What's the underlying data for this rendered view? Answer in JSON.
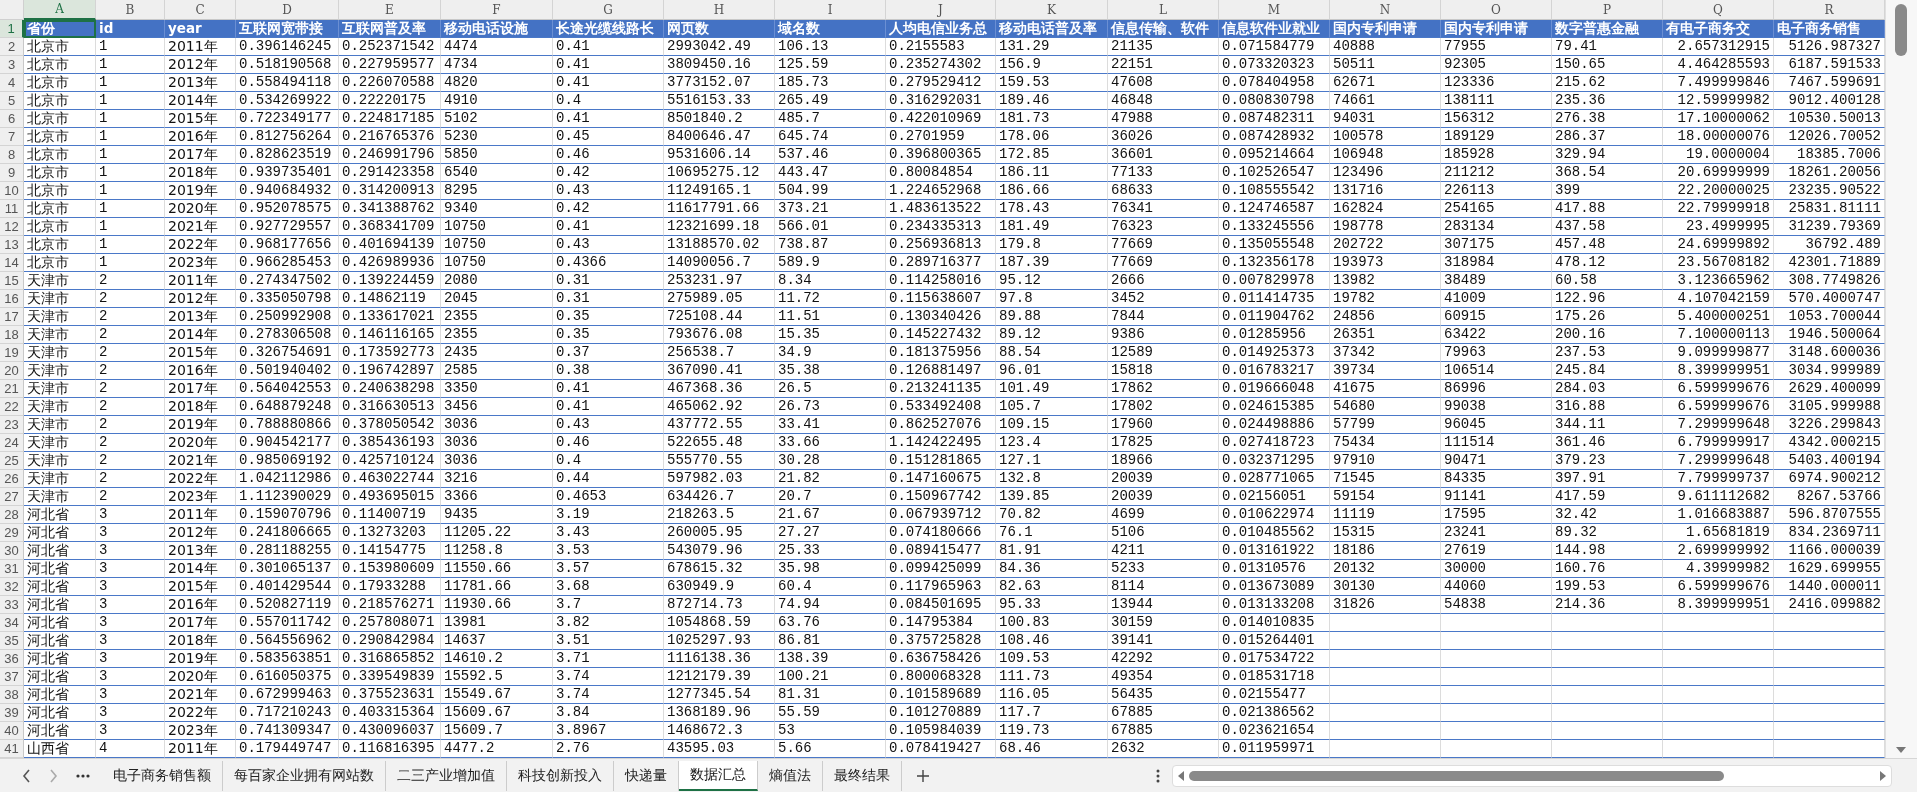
{
  "column_letters": [
    {
      "label": "A",
      "selected": true
    },
    {
      "label": "B",
      "selected": false
    },
    {
      "label": "C",
      "selected": false
    },
    {
      "label": "D",
      "selected": false
    },
    {
      "label": "E",
      "selected": false
    },
    {
      "label": "F",
      "selected": false
    },
    {
      "label": "G",
      "selected": false
    },
    {
      "label": "H",
      "selected": false
    },
    {
      "label": "I",
      "selected": false
    },
    {
      "label": "J",
      "selected": false
    },
    {
      "label": "K",
      "selected": false
    },
    {
      "label": "L",
      "selected": false
    },
    {
      "label": "M",
      "selected": false
    },
    {
      "label": "N",
      "selected": false
    },
    {
      "label": "O",
      "selected": false
    },
    {
      "label": "P",
      "selected": false
    },
    {
      "label": "Q",
      "selected": false
    },
    {
      "label": "R",
      "selected": false
    }
  ],
  "header_row": {
    "number": "1",
    "selected": true,
    "cells": [
      "省份",
      "id",
      "year",
      "互联网宽带接",
      "互联网普及率",
      "移动电话设施",
      "长途光缆线路长",
      "网页数",
      "域名数",
      "人均电信业务总",
      "移动电话普及率",
      "信息传输、软件",
      "信息软件业就业",
      "国内专利申请",
      "国内专利申请",
      "数字普惠金融",
      "有电子商务交",
      "电子商务销售"
    ]
  },
  "rows": [
    {
      "number": "2",
      "selected": false,
      "cells": [
        "北京市",
        "1",
        "2011年",
        "0.396146245",
        "0.252371542",
        "4474",
        "0.41",
        "2993042.49",
        "106.13",
        "0.2155583",
        "131.29",
        "21135",
        "0.071584779",
        "40888",
        "77955",
        "79.41",
        "2.657312915",
        "5126.987327"
      ]
    },
    {
      "number": "3",
      "selected": false,
      "cells": [
        "北京市",
        "1",
        "2012年",
        "0.518190568",
        "0.227959577",
        "4734",
        "0.41",
        "3809450.16",
        "125.59",
        "0.235274302",
        "156.9",
        "22151",
        "0.073320323",
        "50511",
        "92305",
        "150.65",
        "4.464285593",
        "6187.591533"
      ]
    },
    {
      "number": "4",
      "selected": false,
      "cells": [
        "北京市",
        "1",
        "2013年",
        "0.558494118",
        "0.226070588",
        "4820",
        "0.41",
        "3773152.07",
        "185.73",
        "0.279529412",
        "159.53",
        "47608",
        "0.078404958",
        "62671",
        "123336",
        "215.62",
        "7.499999846",
        "7467.599691"
      ]
    },
    {
      "number": "5",
      "selected": false,
      "cells": [
        "北京市",
        "1",
        "2014年",
        "0.534269922",
        "0.22220175",
        "4910",
        "0.4",
        "5516153.33",
        "265.49",
        "0.316292031",
        "189.46",
        "46848",
        "0.080830798",
        "74661",
        "138111",
        "235.36",
        "12.59999982",
        "9012.400128"
      ]
    },
    {
      "number": "6",
      "selected": false,
      "cells": [
        "北京市",
        "1",
        "2015年",
        "0.722349177",
        "0.224817185",
        "5102",
        "0.41",
        "8501840.2",
        "485.7",
        "0.422010969",
        "181.73",
        "47988",
        "0.087482311",
        "94031",
        "156312",
        "276.38",
        "17.10000062",
        "10530.50013"
      ]
    },
    {
      "number": "7",
      "selected": false,
      "cells": [
        "北京市",
        "1",
        "2016年",
        "0.812756264",
        "0.216765376",
        "5230",
        "0.45",
        "8400646.47",
        "645.74",
        "0.2701959",
        "178.06",
        "36026",
        "0.087428932",
        "100578",
        "189129",
        "286.37",
        "18.00000076",
        "12026.70052"
      ]
    },
    {
      "number": "8",
      "selected": false,
      "cells": [
        "北京市",
        "1",
        "2017年",
        "0.828623519",
        "0.246991796",
        "5850",
        "0.46",
        "9531606.14",
        "537.46",
        "0.396800365",
        "172.85",
        "36601",
        "0.095214664",
        "106948",
        "185928",
        "329.94",
        "19.0000004",
        "18385.7006"
      ]
    },
    {
      "number": "9",
      "selected": false,
      "cells": [
        "北京市",
        "1",
        "2018年",
        "0.939735401",
        "0.291423358",
        "6540",
        "0.42",
        "10695275.12",
        "443.47",
        "0.80084854",
        "186.11",
        "77133",
        "0.102526547",
        "123496",
        "211212",
        "368.54",
        "20.69999999",
        "18261.20056"
      ]
    },
    {
      "number": "10",
      "selected": false,
      "cells": [
        "北京市",
        "1",
        "2019年",
        "0.940684932",
        "0.314200913",
        "8295",
        "0.43",
        "11249165.1",
        "504.99",
        "1.224652968",
        "186.66",
        "68633",
        "0.108555542",
        "131716",
        "226113",
        "399",
        "22.20000025",
        "23235.90522"
      ]
    },
    {
      "number": "11",
      "selected": false,
      "cells": [
        "北京市",
        "1",
        "2020年",
        "0.952078575",
        "0.341388762",
        "9340",
        "0.42",
        "11617791.66",
        "373.21",
        "1.483613522",
        "178.43",
        "76341",
        "0.124746587",
        "162824",
        "254165",
        "417.88",
        "22.79999918",
        "25831.81111"
      ]
    },
    {
      "number": "12",
      "selected": false,
      "cells": [
        "北京市",
        "1",
        "2021年",
        "0.927729557",
        "0.368341709",
        "10750",
        "0.41",
        "12321699.18",
        "566.01",
        "0.234335313",
        "181.49",
        "76323",
        "0.133245556",
        "198778",
        "283134",
        "437.58",
        "23.4999995",
        "31239.79369"
      ]
    },
    {
      "number": "13",
      "selected": false,
      "cells": [
        "北京市",
        "1",
        "2022年",
        "0.968177656",
        "0.401694139",
        "10750",
        "0.43",
        "13188570.02",
        "738.87",
        "0.256936813",
        "179.8",
        "77669",
        "0.135055548",
        "202722",
        "307175",
        "457.48",
        "24.69999892",
        "36792.489"
      ]
    },
    {
      "number": "14",
      "selected": false,
      "cells": [
        "北京市",
        "1",
        "2023年",
        "0.966285453",
        "0.426989936",
        "10750",
        "0.4366",
        "14090056.7",
        "589.9",
        "0.289716377",
        "187.39",
        "77669",
        "0.132356178",
        "193973",
        "318984",
        "478.12",
        "23.56708182",
        "42301.71889"
      ]
    },
    {
      "number": "15",
      "selected": false,
      "cells": [
        "天津市",
        "2",
        "2011年",
        "0.274347502",
        "0.139224459",
        "2080",
        "0.31",
        "253231.97",
        "8.34",
        "0.114258016",
        "95.12",
        "2666",
        "0.007829978",
        "13982",
        "38489",
        "60.58",
        "3.123665962",
        "308.7749826"
      ]
    },
    {
      "number": "16",
      "selected": false,
      "cells": [
        "天津市",
        "2",
        "2012年",
        "0.335050798",
        "0.14862119",
        "2045",
        "0.31",
        "275989.05",
        "11.72",
        "0.115638607",
        "97.8",
        "3452",
        "0.011414735",
        "19782",
        "41009",
        "122.96",
        "4.107042159",
        "570.4000747"
      ]
    },
    {
      "number": "17",
      "selected": false,
      "cells": [
        "天津市",
        "2",
        "2013年",
        "0.250992908",
        "0.133617021",
        "2355",
        "0.35",
        "725108.44",
        "11.51",
        "0.130340426",
        "89.88",
        "7844",
        "0.011904762",
        "24856",
        "60915",
        "175.26",
        "5.400000251",
        "1053.700044"
      ]
    },
    {
      "number": "18",
      "selected": false,
      "cells": [
        "天津市",
        "2",
        "2014年",
        "0.278306508",
        "0.146116165",
        "2355",
        "0.35",
        "793676.08",
        "15.35",
        "0.145227432",
        "89.12",
        "9386",
        "0.01285956",
        "26351",
        "63422",
        "200.16",
        "7.100000113",
        "1946.500064"
      ]
    },
    {
      "number": "19",
      "selected": false,
      "cells": [
        "天津市",
        "2",
        "2015年",
        "0.326754691",
        "0.173592773",
        "2435",
        "0.37",
        "256538.7",
        "34.9",
        "0.181375956",
        "88.54",
        "12589",
        "0.014925373",
        "37342",
        "79963",
        "237.53",
        "9.099999877",
        "3148.600036"
      ]
    },
    {
      "number": "20",
      "selected": false,
      "cells": [
        "天津市",
        "2",
        "2016年",
        "0.501940402",
        "0.196742897",
        "2585",
        "0.38",
        "367090.41",
        "35.38",
        "0.126881497",
        "96.01",
        "15818",
        "0.016783217",
        "39734",
        "106514",
        "245.84",
        "8.399999951",
        "3034.999989"
      ]
    },
    {
      "number": "21",
      "selected": false,
      "cells": [
        "天津市",
        "2",
        "2017年",
        "0.564042553",
        "0.240638298",
        "3350",
        "0.41",
        "467368.36",
        "26.5",
        "0.213241135",
        "101.49",
        "17862",
        "0.019666048",
        "41675",
        "86996",
        "284.03",
        "6.599999676",
        "2629.400099"
      ]
    },
    {
      "number": "22",
      "selected": false,
      "cells": [
        "天津市",
        "2",
        "2018年",
        "0.648879248",
        "0.316630513",
        "3456",
        "0.41",
        "465062.92",
        "26.73",
        "0.533492408",
        "105.7",
        "17802",
        "0.024615385",
        "54680",
        "99038",
        "316.88",
        "6.599999676",
        "3105.999988"
      ]
    },
    {
      "number": "23",
      "selected": false,
      "cells": [
        "天津市",
        "2",
        "2019年",
        "0.788880866",
        "0.378050542",
        "3036",
        "0.43",
        "437772.55",
        "33.41",
        "0.862527076",
        "109.15",
        "17960",
        "0.024498886",
        "57799",
        "96045",
        "344.11",
        "7.299999648",
        "3226.299843"
      ]
    },
    {
      "number": "24",
      "selected": false,
      "cells": [
        "天津市",
        "2",
        "2020年",
        "0.904542177",
        "0.385436193",
        "3036",
        "0.46",
        "522655.48",
        "33.66",
        "1.142422495",
        "123.4",
        "17825",
        "0.027418723",
        "75434",
        "111514",
        "361.46",
        "6.799999917",
        "4342.000215"
      ]
    },
    {
      "number": "25",
      "selected": false,
      "cells": [
        "天津市",
        "2",
        "2021年",
        "0.985069192",
        "0.425710124",
        "3036",
        "0.4",
        "555770.55",
        "30.28",
        "0.151281865",
        "127.1",
        "18966",
        "0.032371295",
        "97910",
        "90471",
        "379.23",
        "7.299999648",
        "5403.400194"
      ]
    },
    {
      "number": "26",
      "selected": false,
      "cells": [
        "天津市",
        "2",
        "2022年",
        "1.042112986",
        "0.463022744",
        "3216",
        "0.44",
        "597982.03",
        "21.82",
        "0.147160675",
        "132.8",
        "20039",
        "0.028771065",
        "71545",
        "84335",
        "397.91",
        "7.799999737",
        "6974.900212"
      ]
    },
    {
      "number": "27",
      "selected": false,
      "cells": [
        "天津市",
        "2",
        "2023年",
        "1.112390029",
        "0.493695015",
        "3366",
        "0.4653",
        "634426.7",
        "20.7",
        "0.150967742",
        "139.85",
        "20039",
        "0.02156051",
        "59154",
        "91141",
        "417.59",
        "9.611112682",
        "8267.53766"
      ]
    },
    {
      "number": "28",
      "selected": false,
      "cells": [
        "河北省",
        "3",
        "2011年",
        "0.159070796",
        "0.11400719",
        "9435",
        "3.19",
        "218263.5",
        "21.67",
        "0.067939712",
        "70.82",
        "4699",
        "0.010622974",
        "11119",
        "17595",
        "32.42",
        "1.016683887",
        "596.8707555"
      ]
    },
    {
      "number": "29",
      "selected": false,
      "cells": [
        "河北省",
        "3",
        "2012年",
        "0.241806665",
        "0.13273203",
        "11205.22",
        "3.43",
        "260005.95",
        "27.27",
        "0.074180666",
        "76.1",
        "5106",
        "0.010485562",
        "15315",
        "23241",
        "89.32",
        "1.65681819",
        "834.2369711"
      ]
    },
    {
      "number": "30",
      "selected": false,
      "cells": [
        "河北省",
        "3",
        "2013年",
        "0.281188255",
        "0.14154775",
        "11258.8",
        "3.53",
        "543079.96",
        "25.33",
        "0.089415477",
        "81.91",
        "4211",
        "0.013161922",
        "18186",
        "27619",
        "144.98",
        "2.699999992",
        "1166.000039"
      ]
    },
    {
      "number": "31",
      "selected": false,
      "cells": [
        "河北省",
        "3",
        "2014年",
        "0.301065137",
        "0.153980609",
        "11550.66",
        "3.57",
        "678615.32",
        "35.98",
        "0.099425099",
        "84.36",
        "5233",
        "0.01310576",
        "20132",
        "30000",
        "160.76",
        "4.39999982",
        "1629.699955"
      ]
    },
    {
      "number": "32",
      "selected": false,
      "cells": [
        "河北省",
        "3",
        "2015年",
        "0.401429544",
        "0.17933288",
        "11781.66",
        "3.68",
        "630949.9",
        "60.4",
        "0.117965963",
        "82.63",
        "8114",
        "0.013673089",
        "30130",
        "44060",
        "199.53",
        "6.599999676",
        "1440.000011"
      ]
    },
    {
      "number": "33",
      "selected": false,
      "cells": [
        "河北省",
        "3",
        "2016年",
        "0.520827119",
        "0.218576271",
        "11930.66",
        "3.7",
        "872714.73",
        "74.94",
        "0.084501695",
        "95.33",
        "13944",
        "0.013133208",
        "31826",
        "54838",
        "214.36",
        "8.399999951",
        "2416.099882"
      ]
    },
    {
      "number": "34",
      "selected": false,
      "cells": [
        "河北省",
        "3",
        "2017年",
        "0.557011742",
        "0.257808071",
        "13981",
        "3.82",
        "1054868.59",
        "63.76",
        "0.14795384",
        "100.83",
        "30159",
        "0.014010835"
      ]
    },
    {
      "number": "35",
      "selected": false,
      "cells": [
        "河北省",
        "3",
        "2018年",
        "0.564556962",
        "0.290842984",
        "14637",
        "3.51",
        "1025297.93",
        "86.81",
        "0.375725828",
        "108.46",
        "39141",
        "0.015264401"
      ]
    },
    {
      "number": "36",
      "selected": false,
      "cells": [
        "河北省",
        "3",
        "2019年",
        "0.583563851",
        "0.316865852",
        "14610.2",
        "3.71",
        "1116138.36",
        "138.39",
        "0.636758426",
        "109.53",
        "42292",
        "0.017534722"
      ]
    },
    {
      "number": "37",
      "selected": false,
      "cells": [
        "河北省",
        "3",
        "2020年",
        "0.616050375",
        "0.339549839",
        "15592.5",
        "3.74",
        "1212179.39",
        "100.21",
        "0.800068328",
        "111.73",
        "49354",
        "0.018531718"
      ]
    },
    {
      "number": "38",
      "selected": false,
      "cells": [
        "河北省",
        "3",
        "2021年",
        "0.672999463",
        "0.375523631",
        "15549.67",
        "3.74",
        "1277345.54",
        "81.31",
        "0.101589689",
        "116.05",
        "56435",
        "0.02155477"
      ]
    },
    {
      "number": "39",
      "selected": false,
      "cells": [
        "河北省",
        "3",
        "2022年",
        "0.717210243",
        "0.403315364",
        "15609.67",
        "3.84",
        "1368189.96",
        "55.59",
        "0.101270889",
        "117.7",
        "67885",
        "0.021386562"
      ]
    },
    {
      "number": "40",
      "selected": false,
      "cells": [
        "河北省",
        "3",
        "2023年",
        "0.741309347",
        "0.430096037",
        "15609.7",
        "3.8967",
        "1468672.3",
        "53",
        "0.105984039",
        "119.73",
        "67885",
        "0.023621654"
      ]
    },
    {
      "number": "41",
      "selected": false,
      "cells": [
        "山西省",
        "4",
        "2011年",
        "0.179449747",
        "0.116816395",
        "4477.2",
        "2.76",
        "43595.03",
        "5.66",
        "0.078419427",
        "68.46",
        "2632",
        "0.011959971"
      ]
    }
  ],
  "sheet_tabs": [
    {
      "label": "电子商务销售额",
      "selected": false
    },
    {
      "label": "每百家企业拥有网站数",
      "selected": false
    },
    {
      "label": "二三产业增加值",
      "selected": false
    },
    {
      "label": "科技创新投入",
      "selected": false
    },
    {
      "label": "快递量",
      "selected": false
    },
    {
      "label": "数据汇总",
      "selected": true
    },
    {
      "label": "熵值法",
      "selected": false
    },
    {
      "label": "最终结果",
      "selected": false
    }
  ]
}
